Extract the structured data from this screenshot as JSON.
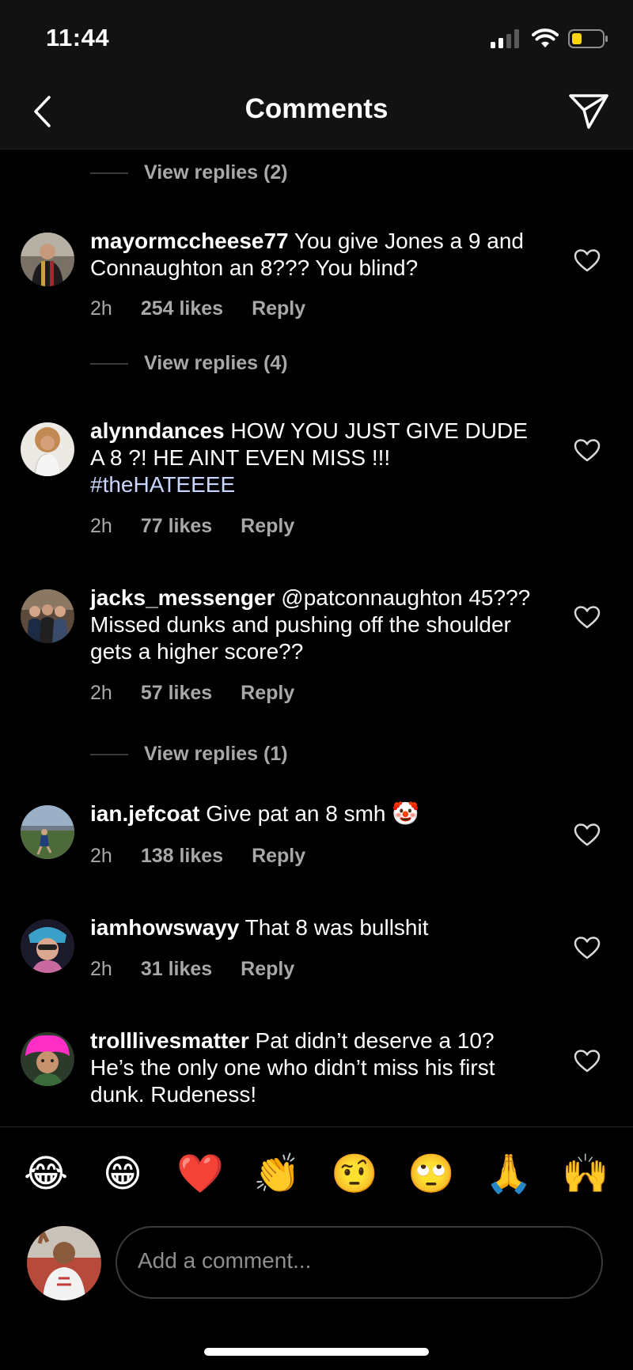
{
  "status": {
    "time": "11:44"
  },
  "header": {
    "title": "Comments"
  },
  "view_replies": [
    {
      "label": "View replies (2)"
    },
    {
      "label": "View replies (4)"
    },
    {
      "label": "View replies (1)"
    }
  ],
  "comments": [
    {
      "username": "mayormccheese77",
      "text": "You give Jones a 9 and Connaughton an 8??? You blind?",
      "time": "2h",
      "likes": "254 likes",
      "reply": "Reply"
    },
    {
      "username": "alynndances",
      "text": "HOW YOU JUST GIVE DUDE A 8 ?! HE AINT EVEN MISS !!!",
      "hashtag": "#theHATEEEE",
      "time": "2h",
      "likes": "77 likes",
      "reply": "Reply"
    },
    {
      "username": "jacks_messenger",
      "text": "@patconnaughton 45??? Missed dunks and pushing off the shoulder gets a higher score??",
      "time": "2h",
      "likes": "57 likes",
      "reply": "Reply"
    },
    {
      "username": "ian.jefcoat",
      "text": "Give pat an 8 smh 🤡",
      "time": "2h",
      "likes": "138 likes",
      "reply": "Reply"
    },
    {
      "username": "iamhowswayy",
      "text": "That 8 was bullshit",
      "time": "2h",
      "likes": "31 likes",
      "reply": "Reply"
    },
    {
      "username": "trolllivesmatter",
      "text": "Pat didn’t deserve a 10? He’s the only one who didn’t miss his first dunk. Rudeness!"
    }
  ],
  "emoji_bar": [
    "😂",
    "😁",
    "❤️",
    "👏",
    "🤨",
    "🙄",
    "🙏",
    "🙌"
  ],
  "composer": {
    "placeholder": "Add a comment..."
  },
  "icons": {
    "back": "chevron-left-icon",
    "send": "paper-plane-icon",
    "like": "heart-outline-icon",
    "signal": "cellular-signal-icon",
    "wifi": "wifi-icon",
    "battery": "battery-low-icon"
  },
  "colors": {
    "background": "#000000",
    "header": "#121212",
    "muted": "#a8a8a8",
    "battery": "#ffd60a"
  }
}
